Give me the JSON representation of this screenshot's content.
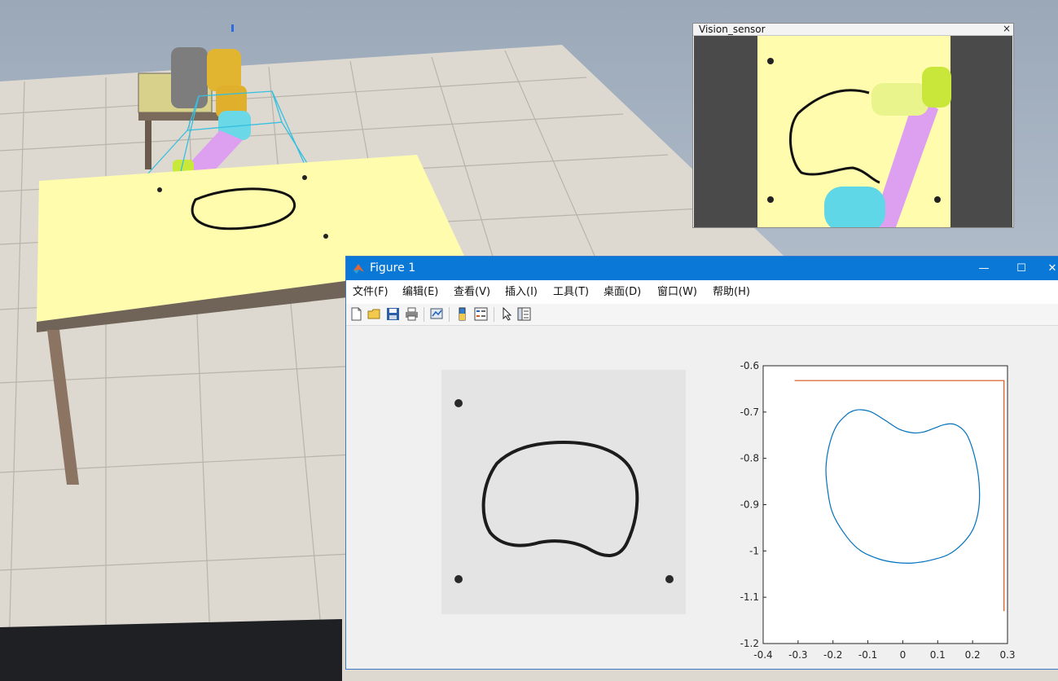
{
  "vision_sensor": {
    "title": "Vision_sensor",
    "close_glyph": "×"
  },
  "figure": {
    "title": "Figure 1",
    "controls": {
      "minimize": "—",
      "maximize": "☐",
      "close": "✕"
    },
    "menu": [
      "文件(F)",
      "编辑(E)",
      "查看(V)",
      "插入(I)",
      "工具(T)",
      "桌面(D)",
      "窗口(W)",
      "帮助(H)"
    ],
    "toolbar": [
      "new-figure",
      "open-file",
      "save",
      "print",
      "link-plot",
      "colorbar",
      "legend",
      "pointer",
      "property-inspector"
    ]
  },
  "chart_data": {
    "type": "line",
    "title": "",
    "xlabel": "",
    "ylabel": "",
    "xlim": [
      -0.4,
      0.3
    ],
    "ylim": [
      -1.2,
      -0.6
    ],
    "xticks": [
      -0.4,
      -0.3,
      -0.2,
      -0.1,
      0,
      0.1,
      0.2,
      0.3
    ],
    "xtick_labels": [
      "-0.4",
      "-0.3",
      "-0.2",
      "-0.1",
      "0",
      "0.1",
      "0.2",
      "0.3"
    ],
    "yticks": [
      -0.6,
      -0.7,
      -0.8,
      -0.9,
      -1,
      -1.1,
      -1.2
    ],
    "ytick_labels": [
      "-0.6",
      "-0.7",
      "-0.8",
      "-0.9",
      "-1",
      "-1.1",
      "-1.2"
    ],
    "grid": false,
    "series": [
      {
        "color": "#0072bd",
        "x": [
          -0.12,
          -0.09,
          -0.05,
          -0.01,
          0.03,
          0.06,
          0.09,
          0.12,
          0.15,
          0.18,
          0.2,
          0.215,
          0.22,
          0.215,
          0.2,
          0.17,
          0.13,
          0.08,
          0.03,
          -0.02,
          -0.07,
          -0.12,
          -0.16,
          -0.2,
          -0.215,
          -0.22,
          -0.21,
          -0.19,
          -0.16,
          -0.14,
          -0.12
        ],
        "y": [
          -0.695,
          -0.7,
          -0.718,
          -0.737,
          -0.745,
          -0.743,
          -0.735,
          -0.727,
          -0.727,
          -0.745,
          -0.78,
          -0.83,
          -0.88,
          -0.92,
          -0.955,
          -0.985,
          -1.008,
          -1.02,
          -1.026,
          -1.025,
          -1.017,
          -1.0,
          -0.97,
          -0.92,
          -0.87,
          -0.82,
          -0.77,
          -0.73,
          -0.705,
          -0.697,
          -0.695
        ]
      },
      {
        "color": "#d95319",
        "x": [
          -0.31,
          0.29,
          0.29
        ],
        "y": [
          -0.632,
          -0.632,
          -1.13
        ]
      }
    ]
  }
}
